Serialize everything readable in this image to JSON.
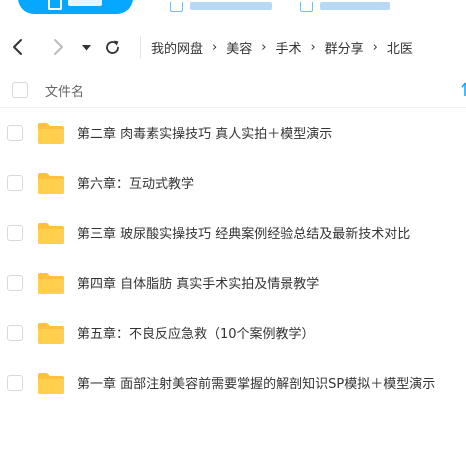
{
  "toolbar": {
    "icons": [
      "upload-icon",
      "new-folder-icon",
      "offline-download-icon"
    ]
  },
  "nav": {
    "back_icon": "chevron-left-icon",
    "forward_icon": "chevron-right-icon",
    "dropdown_icon": "caret-down-icon",
    "refresh_icon": "refresh-icon"
  },
  "breadcrumb": {
    "items": [
      "我的网盘",
      "美容",
      "手术",
      "群分享",
      "北医"
    ],
    "separator": "›"
  },
  "header": {
    "name_column": "文件名"
  },
  "files": [
    {
      "name": "第二章 肉毒素实操技巧 真人实拍＋模型演示"
    },
    {
      "name": "第六章：互动式教学"
    },
    {
      "name": "第三章 玻尿酸实操技巧 经典案例经验总结及最新技术对比"
    },
    {
      "name": "第四章 自体脂肪 真实手术实拍及情景教学"
    },
    {
      "name": "第五章：不良反应急救（10个案例教学）"
    },
    {
      "name": "第一章 面部注射美容前需要掌握的解剖知识SP模拟＋模型演示"
    }
  ],
  "colors": {
    "accent": "#06a7ff",
    "folder": "#ffc13d",
    "text": "#333333"
  }
}
